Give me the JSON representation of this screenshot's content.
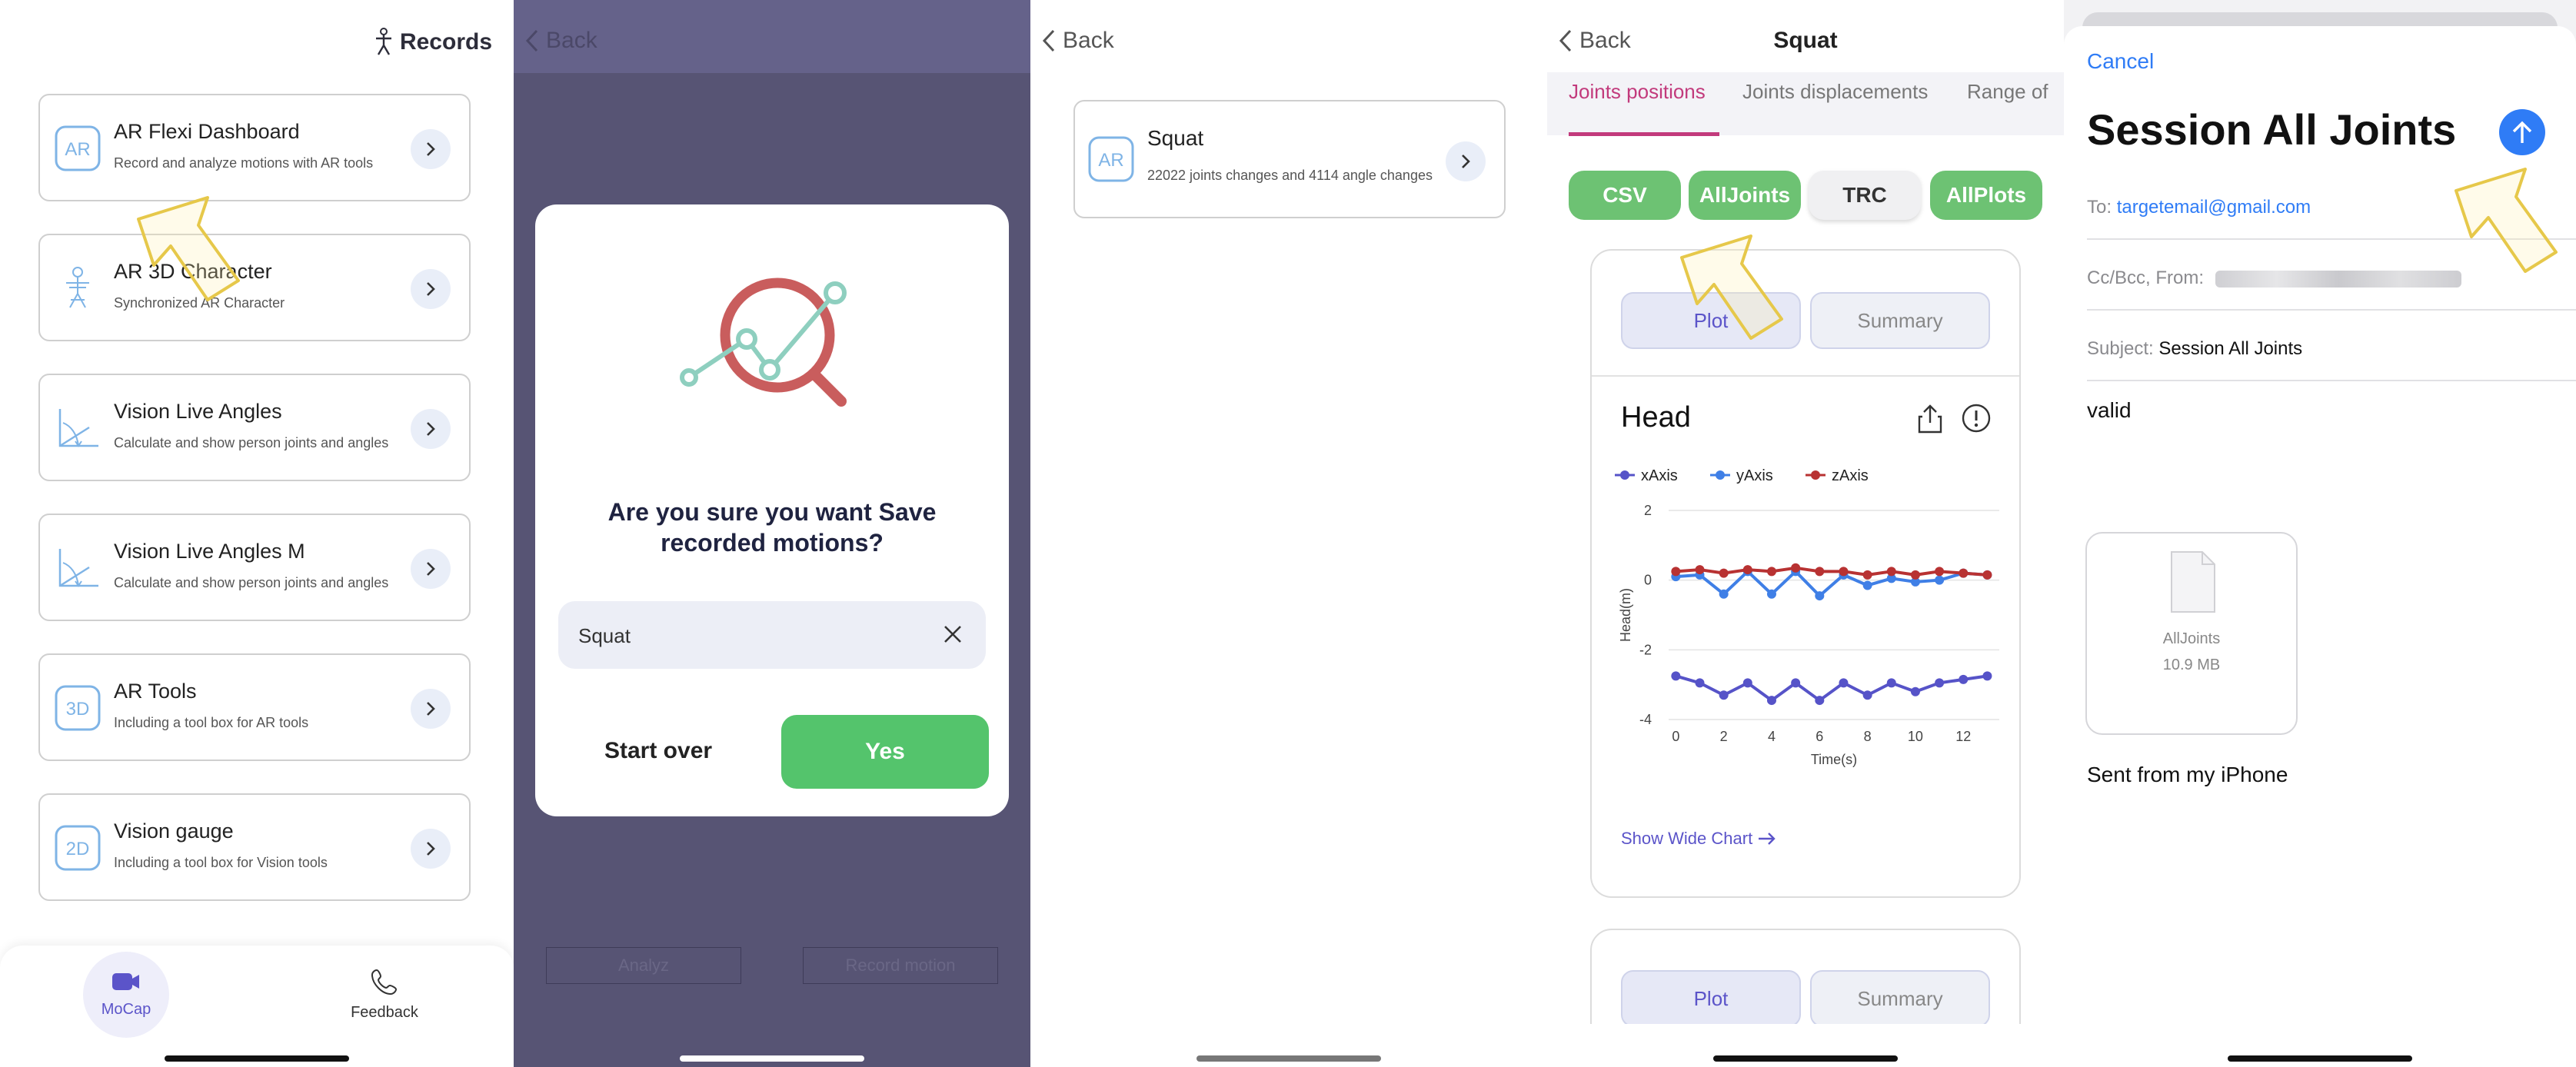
{
  "panel1": {
    "title": "Records",
    "cards": [
      {
        "name": "AR Flexi Dashboard",
        "desc": "Record and analyze motions with AR tools",
        "icon": "ar-badge-icon",
        "badge": "AR"
      },
      {
        "name": "AR 3D Character",
        "desc": "Synchronized AR Character",
        "icon": "skeleton-icon",
        "badge": ""
      },
      {
        "name": "Vision Live Angles",
        "desc": "Calculate and show person joints and angles",
        "icon": "angle-icon",
        "badge": ""
      },
      {
        "name": "Vision Live Angles M",
        "desc": "Calculate and show person joints and angles",
        "icon": "angle-icon",
        "badge": ""
      },
      {
        "name": "AR Tools",
        "desc": "Including a tool box for AR tools",
        "icon": "3d-badge-icon",
        "badge": "3D"
      },
      {
        "name": "Vision gauge",
        "desc": "Including a tool box for Vision tools",
        "icon": "2d-badge-icon",
        "badge": "2D"
      }
    ],
    "tabs": [
      {
        "label": "MoCap"
      },
      {
        "label": "Feedback"
      }
    ]
  },
  "panel2": {
    "back": "Back",
    "question": "Are you sure you want Save recorded motions?",
    "input_value": "Squat",
    "start_over": "Start over",
    "yes": "Yes",
    "bottom_left": "Analyz",
    "bottom_right": "Record motion"
  },
  "panel3": {
    "back": "Back",
    "item_badge": "AR",
    "item_title": "Squat",
    "item_desc": "22022 joints changes and 4114 angle changes"
  },
  "panel4": {
    "back": "Back",
    "title": "Squat",
    "segments": [
      "Joints positions",
      "Joints displacements",
      "Range of"
    ],
    "pills": [
      "CSV",
      "AllJoints",
      "TRC",
      "AllPlots"
    ],
    "plot_label": "Plot",
    "summary_label": "Summary",
    "show_wide": "Show Wide Chart"
  },
  "panel5": {
    "cancel": "Cancel",
    "subject_title": "Session All Joints",
    "to_label": "To:",
    "to_value": "targetemail@gmail.com",
    "cc_label": "Cc/Bcc, From:",
    "subject_label": "Subject:",
    "subject_value": "Session All Joints",
    "body": "valid",
    "attachment_name": "AllJoints",
    "attachment_size": "10.9 MB",
    "signature": "Sent from my iPhone"
  },
  "colors": {
    "accent_purple": "#5b54c9",
    "green": "#54c46c",
    "chart_x": "#5653c8",
    "chart_y": "#3f7fe6",
    "chart_z": "#b83232",
    "mail_blue": "#2f7cf6"
  },
  "chart_data": {
    "type": "line",
    "title": "Head",
    "xlabel": "Time(s)",
    "ylabel": "Head(m)",
    "xlim": [
      -0.3,
      13.5
    ],
    "ylim": [
      -4,
      2
    ],
    "xticks": [
      "0",
      "2",
      "4",
      "6",
      "8",
      "10",
      "12"
    ],
    "yticks": [
      "2",
      "0",
      "-2",
      "-4"
    ],
    "legend": "top-left",
    "grid": true,
    "x": [
      0,
      1,
      2,
      3,
      4,
      5,
      6,
      7,
      8,
      9,
      10,
      11,
      12,
      13
    ],
    "series": [
      {
        "name": "xAxis",
        "color": "#5653c8",
        "values": [
          -2.75,
          -2.95,
          -3.3,
          -2.95,
          -3.45,
          -2.95,
          -3.45,
          -2.95,
          -3.3,
          -2.95,
          -3.2,
          -2.95,
          -2.85,
          -2.75
        ]
      },
      {
        "name": "yAxis",
        "color": "#3f7fe6",
        "values": [
          0.1,
          0.15,
          -0.4,
          0.25,
          -0.4,
          0.25,
          -0.45,
          0.15,
          -0.15,
          0.05,
          -0.05,
          0.0,
          0.2,
          0.15
        ]
      },
      {
        "name": "zAxis",
        "color": "#b83232",
        "values": [
          0.25,
          0.3,
          0.2,
          0.3,
          0.25,
          0.35,
          0.25,
          0.25,
          0.15,
          0.25,
          0.15,
          0.25,
          0.2,
          0.15
        ]
      }
    ]
  }
}
